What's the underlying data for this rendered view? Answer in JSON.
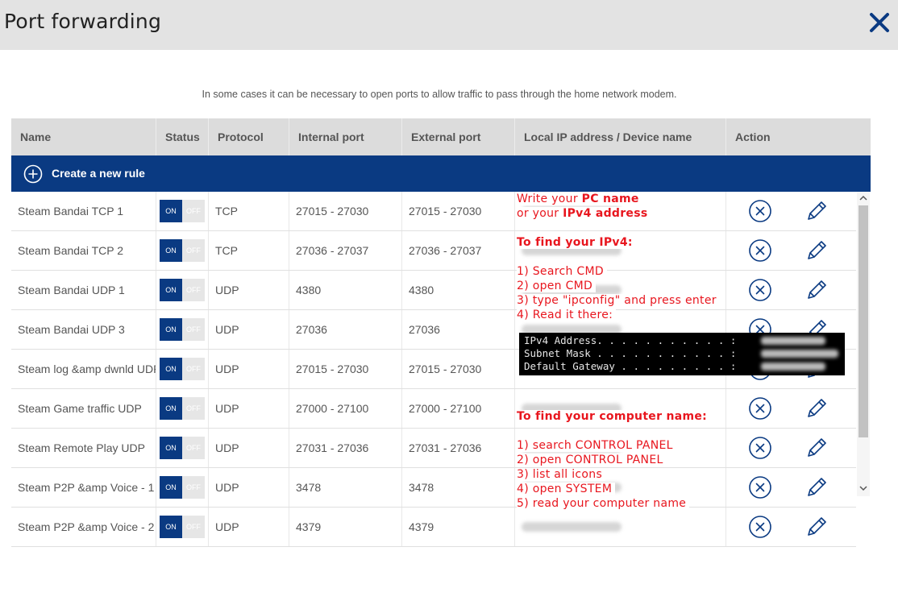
{
  "window": {
    "title": "Port forwarding"
  },
  "intro_text": "In some cases it can be necessary to open ports to allow traffic to pass through the home network modem.",
  "table": {
    "headers": {
      "name": "Name",
      "status": "Status",
      "protocol": "Protocol",
      "internal": "Internal port",
      "external": "External port",
      "ip": "Local IP address / Device name",
      "action": "Action"
    },
    "create_rule_label": "Create a new rule",
    "toggle": {
      "on": "ON",
      "off": "OFF"
    },
    "rows": [
      {
        "name": "Steam Bandai TCP 1",
        "protocol": "TCP",
        "internal": "27015 - 27030",
        "external": "27015 - 27030",
        "status": "ON"
      },
      {
        "name": "Steam Bandai TCP 2",
        "protocol": "TCP",
        "internal": "27036 - 27037",
        "external": "27036 - 27037",
        "status": "ON"
      },
      {
        "name": "Steam Bandai UDP 1",
        "protocol": "UDP",
        "internal": "4380",
        "external": "4380",
        "status": "ON"
      },
      {
        "name": "Steam Bandai UDP 3",
        "protocol": "UDP",
        "internal": "27036",
        "external": "27036",
        "status": "ON"
      },
      {
        "name": "Steam log &amp dwnld UDP",
        "protocol": "UDP",
        "internal": "27015 - 27030",
        "external": "27015 - 27030",
        "status": "ON"
      },
      {
        "name": "Steam Game traffic UDP",
        "protocol": "UDP",
        "internal": "27000 - 27100",
        "external": "27000 - 27100",
        "status": "ON"
      },
      {
        "name": "Steam Remote Play UDP",
        "protocol": "UDP",
        "internal": "27031 - 27036",
        "external": "27031 - 27036",
        "status": "ON"
      },
      {
        "name": "Steam P2P &amp Voice - 1",
        "protocol": "UDP",
        "internal": "3478",
        "external": "3478",
        "status": "ON"
      },
      {
        "name": "Steam P2P &amp Voice - 2",
        "protocol": "UDP",
        "internal": "4379",
        "external": "4379",
        "status": "ON"
      }
    ]
  },
  "annotation": {
    "write_prefix": "Write your ",
    "pc_name": "PC name",
    "or_your": "or your ",
    "ipv4_address": "IPv4 address",
    "find_ipv4_title": "To find your IPv4:",
    "ipv4_steps": [
      "1) Search CMD",
      "2) open CMD",
      "3) type \"ipconfig\" and press enter",
      "4) Read it there:"
    ],
    "cmd_lines": [
      "IPv4 Address. . . . . . . . . . . :",
      "Subnet Mask . . . . . . . . . . . :",
      "Default Gateway . . . . . . . . . :"
    ],
    "find_name_title": "To find your computer name:",
    "name_steps": [
      "1) search CONTROL PANEL",
      "2) open CONTROL PANEL",
      "3) list all icons",
      "4) open SYSTEM",
      "5) read your computer name"
    ]
  },
  "colors": {
    "brand_blue": "#0a3a82",
    "annotation_red": "#e8161e",
    "header_bg": "#e3e3e3"
  },
  "icons": {
    "close": "close-x-icon",
    "create": "plus-circle-icon",
    "delete": "x-circle-icon",
    "edit": "pencil-icon"
  }
}
